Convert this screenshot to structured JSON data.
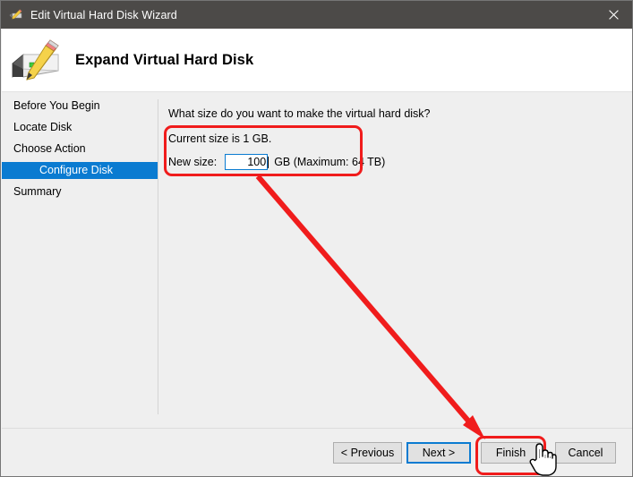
{
  "window": {
    "title": "Edit Virtual Hard Disk Wizard",
    "title_icon": "disk-pencil-icon",
    "close_label": "✕"
  },
  "header": {
    "title": "Expand Virtual Hard Disk",
    "icon": "disk-pencil-icon"
  },
  "sidebar": {
    "items": [
      {
        "label": "Before You Begin",
        "selected": false,
        "sub": false
      },
      {
        "label": "Locate Disk",
        "selected": false,
        "sub": false
      },
      {
        "label": "Choose Action",
        "selected": false,
        "sub": false
      },
      {
        "label": "Configure Disk",
        "selected": true,
        "sub": true
      },
      {
        "label": "Summary",
        "selected": false,
        "sub": false
      }
    ]
  },
  "content": {
    "question": "What size do you want to make the virtual hard disk?",
    "current_size": "Current size is 1 GB.",
    "new_size_label": "New size:",
    "new_size_value": "100",
    "new_size_placeholder": "",
    "units": "GB (Maximum: 64 TB)"
  },
  "footer": {
    "buttons": [
      {
        "label": "< Previous",
        "id": "previous"
      },
      {
        "label": "Next >",
        "id": "next"
      },
      {
        "label": "Finish",
        "id": "finish"
      },
      {
        "label": "Cancel",
        "id": "cancel"
      }
    ]
  },
  "annotations": {
    "highlight_color": "#f01c1c",
    "focus_color": "#0a7bd1",
    "selection_color": "#0a7bd1",
    "arrow": {
      "from": [
        287,
        196
      ],
      "to": [
        540,
        489
      ]
    },
    "cursor": "hand-pointer-cursor"
  }
}
